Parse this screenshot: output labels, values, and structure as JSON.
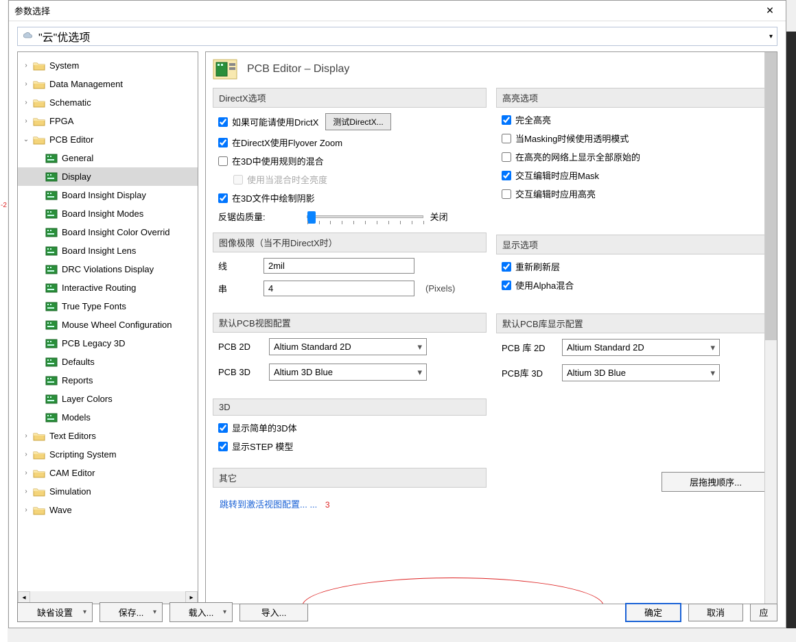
{
  "window": {
    "title": "参数选择"
  },
  "cloud": {
    "label": "\"云\"优选项"
  },
  "tree": {
    "nodes": [
      {
        "label": "System",
        "level": 0,
        "expanded": false,
        "type": "folder"
      },
      {
        "label": "Data Management",
        "level": 0,
        "expanded": false,
        "type": "folder"
      },
      {
        "label": "Schematic",
        "level": 0,
        "expanded": false,
        "type": "folder"
      },
      {
        "label": "FPGA",
        "level": 0,
        "expanded": false,
        "type": "folder"
      },
      {
        "label": "PCB Editor",
        "level": 0,
        "expanded": true,
        "type": "folder"
      },
      {
        "label": "General",
        "level": 1,
        "type": "leaf"
      },
      {
        "label": "Display",
        "level": 1,
        "type": "leaf",
        "selected": true
      },
      {
        "label": "Board Insight Display",
        "level": 1,
        "type": "leaf"
      },
      {
        "label": "Board Insight Modes",
        "level": 1,
        "type": "leaf"
      },
      {
        "label": "Board Insight Color Overrid",
        "level": 1,
        "type": "leaf"
      },
      {
        "label": "Board Insight Lens",
        "level": 1,
        "type": "leaf"
      },
      {
        "label": "DRC Violations Display",
        "level": 1,
        "type": "leaf"
      },
      {
        "label": "Interactive Routing",
        "level": 1,
        "type": "leaf"
      },
      {
        "label": "True Type Fonts",
        "level": 1,
        "type": "leaf"
      },
      {
        "label": "Mouse Wheel Configuration",
        "level": 1,
        "type": "leaf"
      },
      {
        "label": "PCB Legacy 3D",
        "level": 1,
        "type": "leaf"
      },
      {
        "label": "Defaults",
        "level": 1,
        "type": "leaf"
      },
      {
        "label": "Reports",
        "level": 1,
        "type": "leaf"
      },
      {
        "label": "Layer Colors",
        "level": 1,
        "type": "leaf"
      },
      {
        "label": "Models",
        "level": 1,
        "type": "leaf"
      },
      {
        "label": "Text Editors",
        "level": 0,
        "expanded": false,
        "type": "folder"
      },
      {
        "label": "Scripting System",
        "level": 0,
        "expanded": false,
        "type": "folder"
      },
      {
        "label": "CAM Editor",
        "level": 0,
        "expanded": false,
        "type": "folder"
      },
      {
        "label": "Simulation",
        "level": 0,
        "expanded": false,
        "type": "folder"
      },
      {
        "label": "Wave",
        "level": 0,
        "expanded": false,
        "type": "folder"
      }
    ]
  },
  "page": {
    "title": "PCB Editor – Display"
  },
  "groups": {
    "directx": {
      "title": "DirectX选项",
      "use_drictx": {
        "label": "如果可能请使用DrictX",
        "checked": true
      },
      "test_btn": "测试DirectX...",
      "flyover": {
        "label": "在DirectX使用Flyover Zoom",
        "checked": true
      },
      "mix3d": {
        "label": "在3D中使用规则的混合",
        "checked": false
      },
      "mix_bright": {
        "label": "使用当混合时全亮度",
        "checked": false
      },
      "shadow3d": {
        "label": "在3D文件中绘制阴影",
        "checked": true
      },
      "antialias_label": "反锯齿质量:",
      "antialias_right": "关闭"
    },
    "highlight": {
      "title": "高亮选项",
      "full": {
        "label": "完全高亮",
        "checked": true
      },
      "mask_trans": {
        "label": "当Masking时候使用透明模式",
        "checked": false
      },
      "show_all": {
        "label": "在高亮的网络上显示全部原始的",
        "checked": false
      },
      "apply_mask": {
        "label": "交互编辑时应用Mask",
        "checked": true
      },
      "apply_highlight": {
        "label": "交互编辑时应用高亮",
        "checked": false
      }
    },
    "image_limit": {
      "title": "图像极限（当不用DirectX时）",
      "line_label": "线",
      "line_value": "2mil",
      "string_label": "串",
      "string_value": "4",
      "string_suffix": "(Pixels)"
    },
    "display_opts": {
      "title": "显示选项",
      "refresh": {
        "label": "重新刷新层",
        "checked": true
      },
      "alpha": {
        "label": "使用Alpha混合",
        "checked": true
      }
    },
    "pcb_view": {
      "title": "默认PCB视图配置",
      "pcb2d_label": "PCB 2D",
      "pcb2d_value": "Altium Standard 2D",
      "pcb3d_label": "PCB 3D",
      "pcb3d_value": "Altium 3D Blue"
    },
    "pcb_lib": {
      "title": "默认PCB库显示配置",
      "lib2d_label": "PCB 库 2D",
      "lib2d_value": "Altium Standard 2D",
      "lib3d_label": "PCB库 3D",
      "lib3d_value": "Altium 3D Blue"
    },
    "three_d": {
      "title": "3D",
      "simple": {
        "label": "显示简单的3D体",
        "checked": true
      },
      "step": {
        "label": "显示STEP 模型",
        "checked": true
      }
    },
    "other": {
      "title": "其它",
      "link": "跳转到激活视图配置... ...",
      "num": "3",
      "layer_btn": "层拖拽顺序..."
    }
  },
  "footer": {
    "defaults": "缺省设置",
    "save": "保存...",
    "load": "载入...",
    "import": "导入...",
    "ok": "确定",
    "cancel": "取消",
    "apply": "应"
  }
}
